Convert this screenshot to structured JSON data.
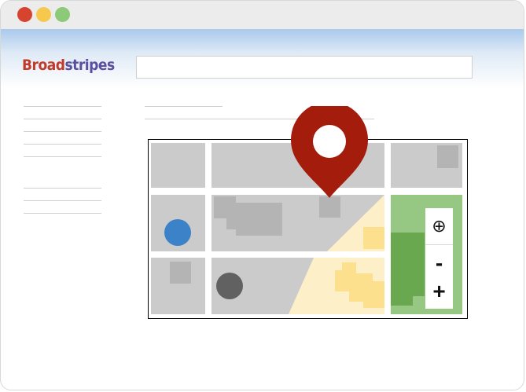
{
  "window": {
    "controls": [
      {
        "name": "close-button",
        "color": "#d6432e"
      },
      {
        "name": "minimize-button",
        "color": "#f6c94e"
      },
      {
        "name": "maximize-button",
        "color": "#8cc978"
      }
    ]
  },
  "header": {
    "logo": {
      "part1": "Broad",
      "part2": "stripes"
    },
    "search": {
      "placeholder": "",
      "value": ""
    }
  },
  "map": {
    "icons": [
      "location-pin-icon",
      "blue-location-dot-icon",
      "gray-location-dot-icon"
    ],
    "controls": {
      "locate_icon": "⊕",
      "zoom_out_label": "-",
      "zoom_in_label": "+"
    },
    "colors": {
      "pin": "#a31c0c",
      "block": "#cbcbcb",
      "building": "#b4b4b4",
      "park": "#96c783",
      "park_dark": "#6aa84f",
      "zone_light": "#fdf0c8",
      "zone_yellow": "#fde08e",
      "blue_dot": "#3b82c9",
      "gray_dot": "#616161"
    }
  }
}
